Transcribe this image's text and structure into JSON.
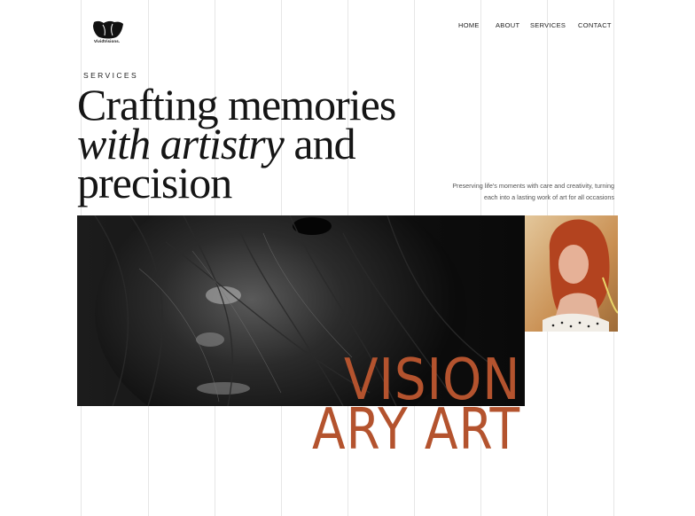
{
  "brand": {
    "name": "VividVisions."
  },
  "nav": {
    "items": [
      {
        "label": "HOME"
      },
      {
        "label": "ABOUT"
      },
      {
        "label": "SERVICES"
      },
      {
        "label": "CONTACT"
      }
    ]
  },
  "hero": {
    "eyebrow": "SERVICES",
    "headline_line1": "Crafting memories",
    "headline_italic": "with artistry",
    "headline_line2_rest": " and",
    "headline_line3": "precision",
    "tagline_line1": "Preserving life's moments with care and creativity, turning",
    "tagline_line2": "each into a lasting work of art for all occasions"
  },
  "feature": {
    "title_line1": "VISION",
    "title_line2": "ARY ART"
  },
  "colors": {
    "accent": "#b4532e",
    "text": "#151515",
    "grid": "#e6e6e6"
  },
  "images": {
    "main": "close-up portrait of a face behind dark hair, black and white",
    "side": "portrait of a red-haired woman in warm light"
  }
}
